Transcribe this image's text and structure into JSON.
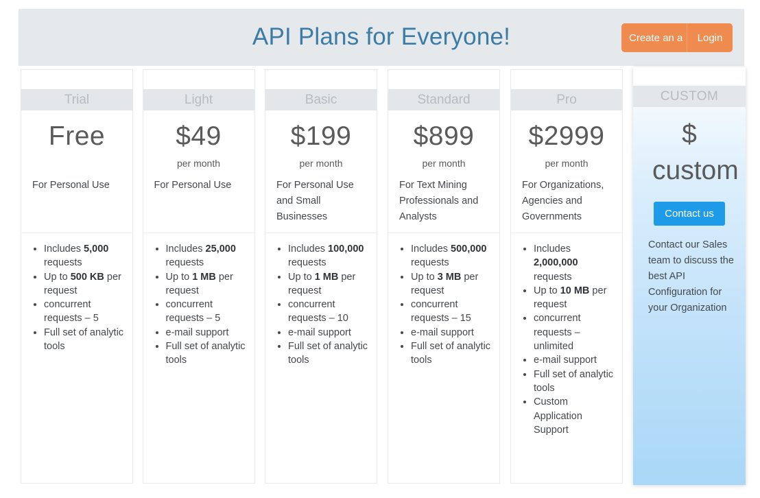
{
  "header": {
    "title": "API Plans for Everyone!",
    "create_account_label": "Create an a",
    "login_label": "Login",
    "button_color": "#ef8b4e",
    "title_color": "#3a7ca5"
  },
  "plans": [
    {
      "name": "Trial",
      "price": "Free",
      "period": "",
      "description": "For Personal Use",
      "features": [
        {
          "pre": "Includes ",
          "strong": "5,000",
          "post": " requests"
        },
        {
          "pre": "Up to ",
          "strong": "500 KB",
          "post": " per request"
        },
        {
          "pre": "concurrent requests – 5",
          "strong": "",
          "post": ""
        },
        {
          "pre": "Full set of analytic tools",
          "strong": "",
          "post": ""
        }
      ]
    },
    {
      "name": "Light",
      "price": "$49",
      "period": "per month",
      "description": "For Personal Use",
      "features": [
        {
          "pre": "Includes ",
          "strong": "25,000",
          "post": " requests"
        },
        {
          "pre": "Up to ",
          "strong": "1 MB",
          "post": " per request"
        },
        {
          "pre": "concurrent requests – 5",
          "strong": "",
          "post": ""
        },
        {
          "pre": "e-mail support",
          "strong": "",
          "post": ""
        },
        {
          "pre": "Full set of analytic tools",
          "strong": "",
          "post": ""
        }
      ]
    },
    {
      "name": "Basic",
      "price": "$199",
      "period": "per month",
      "description": "For Personal Use and Small Businesses",
      "features": [
        {
          "pre": "Includes ",
          "strong": "100,000",
          "post": " requests"
        },
        {
          "pre": "Up to ",
          "strong": "1 MB",
          "post": " per request"
        },
        {
          "pre": "concurrent requests – 10",
          "strong": "",
          "post": ""
        },
        {
          "pre": "e-mail support",
          "strong": "",
          "post": ""
        },
        {
          "pre": "Full set of analytic tools",
          "strong": "",
          "post": ""
        }
      ]
    },
    {
      "name": "Standard",
      "price": "$899",
      "period": "per month",
      "description": "For Text Mining Professionals and Analysts",
      "features": [
        {
          "pre": "Includes ",
          "strong": "500,000",
          "post": " requests"
        },
        {
          "pre": "Up to ",
          "strong": "3 MB",
          "post": " per request"
        },
        {
          "pre": "concurrent requests – 15",
          "strong": "",
          "post": ""
        },
        {
          "pre": "e-mail support",
          "strong": "",
          "post": ""
        },
        {
          "pre": "Full set of analytic tools",
          "strong": "",
          "post": ""
        }
      ]
    },
    {
      "name": "Pro",
      "price": "$2999",
      "period": "per month",
      "description": "For Organizations, Agencies and Governments",
      "features": [
        {
          "pre": "Includes ",
          "strong": "2,000,000",
          "post": " requests"
        },
        {
          "pre": "Up to ",
          "strong": "10 MB",
          "post": " per request"
        },
        {
          "pre": "concurrent requests – unlimited",
          "strong": "",
          "post": ""
        },
        {
          "pre": "e-mail support",
          "strong": "",
          "post": ""
        },
        {
          "pre": "Full set of analytic tools",
          "strong": "",
          "post": ""
        },
        {
          "pre": "Custom Application Support",
          "strong": "",
          "post": ""
        }
      ]
    }
  ],
  "custom_plan": {
    "name": "CUSTOM",
    "price": "$ custom",
    "contact_label": "Contact us",
    "contact_color": "#1e9be8",
    "description": "Contact our Sales team to discuss the best API Configuration for your Organization"
  }
}
